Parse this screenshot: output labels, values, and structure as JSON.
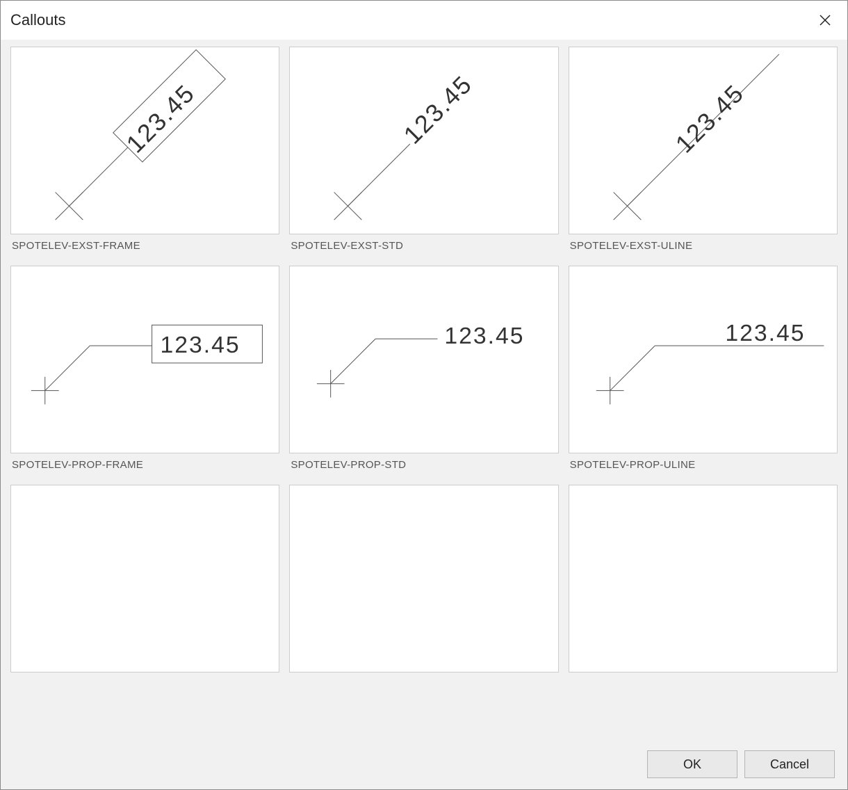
{
  "title": "Callouts",
  "sample_value": "123.45",
  "items": [
    {
      "label": "SPOTELEV-EXST-FRAME",
      "kind": "diag-frame"
    },
    {
      "label": "SPOTELEV-EXST-STD",
      "kind": "diag-plain"
    },
    {
      "label": "SPOTELEV-EXST-ULINE",
      "kind": "diag-uline"
    },
    {
      "label": "SPOTELEV-PROP-FRAME",
      "kind": "horiz-frame"
    },
    {
      "label": "SPOTELEV-PROP-STD",
      "kind": "horiz-plain"
    },
    {
      "label": "SPOTELEV-PROP-ULINE",
      "kind": "horiz-uline"
    },
    {
      "label": "",
      "kind": "empty"
    },
    {
      "label": "",
      "kind": "empty"
    },
    {
      "label": "",
      "kind": "empty"
    }
  ],
  "buttons": {
    "ok": "OK",
    "cancel": "Cancel"
  }
}
